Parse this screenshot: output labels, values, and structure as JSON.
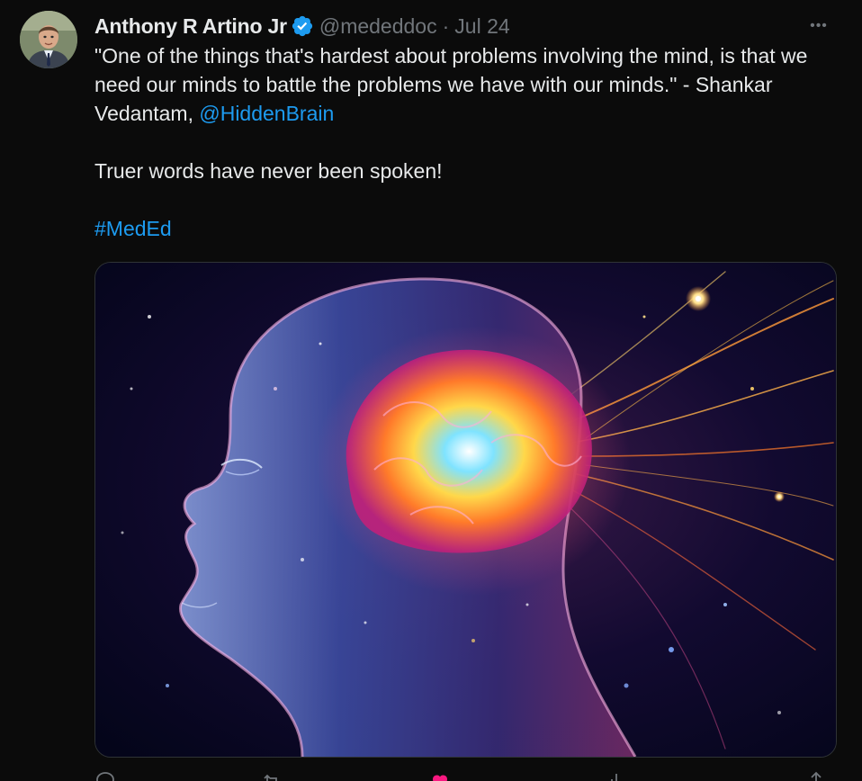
{
  "tweet": {
    "display_name": "Anthony R Artino Jr",
    "handle": "@mededdoc",
    "separator": "·",
    "date": "Jul 24",
    "more_label": "•••",
    "body": {
      "quote_text": "\"One of the things that's hardest about problems involving the mind, is that we need our minds to battle the problems we have with our minds.\" - Shankar Vedantam, ",
      "mention": "@HiddenBrain",
      "second_paragraph": "Truer words have never been spoken!",
      "hashtag": "#MedEd"
    },
    "colors": {
      "link": "#1d9bf0",
      "verified": "#1d9bf0",
      "muted": "#71767b",
      "text": "#e7e9ea",
      "like": "#f91880"
    },
    "icons": {
      "verified": "verified-badge-icon",
      "more": "more-dots-icon",
      "reply": "reply-icon",
      "retweet": "retweet-icon",
      "like": "heart-icon",
      "views": "views-icon",
      "share": "share-icon"
    }
  }
}
